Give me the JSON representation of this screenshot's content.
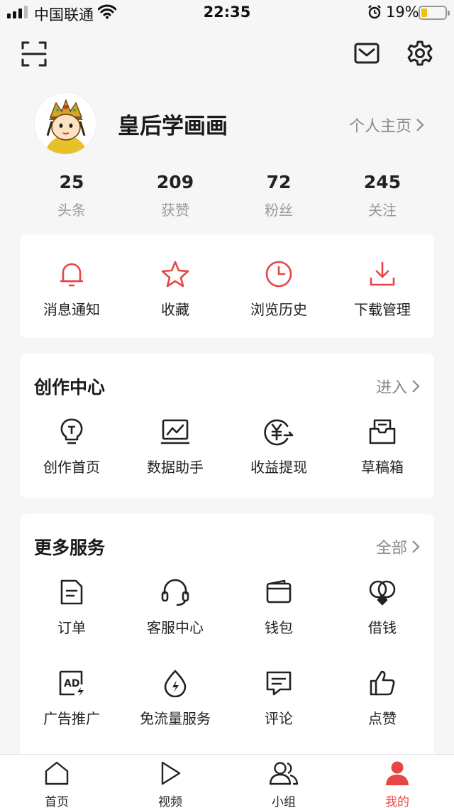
{
  "status_bar": {
    "carrier": "中国联通",
    "time": "22:35",
    "battery": "19%"
  },
  "profile": {
    "nickname": "皇后学画画",
    "homepage_label": "个人主页"
  },
  "stats": [
    {
      "value": "25",
      "label": "头条"
    },
    {
      "value": "209",
      "label": "获赞"
    },
    {
      "value": "72",
      "label": "粉丝"
    },
    {
      "value": "245",
      "label": "关注"
    }
  ],
  "quick_actions": [
    {
      "label": "消息通知",
      "icon": "bell-icon"
    },
    {
      "label": "收藏",
      "icon": "star-icon"
    },
    {
      "label": "浏览历史",
      "icon": "clock-icon"
    },
    {
      "label": "下载管理",
      "icon": "download-icon"
    }
  ],
  "creator_center": {
    "title": "创作中心",
    "more": "进入",
    "items": [
      {
        "label": "创作首页",
        "icon": "lightbulb-icon"
      },
      {
        "label": "数据助手",
        "icon": "chart-monitor-icon"
      },
      {
        "label": "收益提现",
        "icon": "yen-exchange-icon"
      },
      {
        "label": "草稿箱",
        "icon": "draft-box-icon"
      }
    ]
  },
  "more_services": {
    "title": "更多服务",
    "more": "全部",
    "items": [
      {
        "label": "订单",
        "icon": "document-icon"
      },
      {
        "label": "客服中心",
        "icon": "headset-icon"
      },
      {
        "label": "钱包",
        "icon": "wallet-icon"
      },
      {
        "label": "借钱",
        "icon": "loan-icon"
      },
      {
        "label": "广告推广",
        "icon": "ad-icon"
      },
      {
        "label": "免流量服务",
        "icon": "data-drop-icon"
      },
      {
        "label": "评论",
        "icon": "comment-icon"
      },
      {
        "label": "点赞",
        "icon": "thumbs-up-icon"
      }
    ]
  },
  "tabbar": [
    {
      "label": "首页",
      "icon": "home-icon"
    },
    {
      "label": "视频",
      "icon": "play-icon"
    },
    {
      "label": "小组",
      "icon": "group-icon"
    },
    {
      "label": "我的",
      "icon": "user-icon",
      "active": true
    }
  ],
  "colors": {
    "accent": "#e84545",
    "background": "#f6f6f6",
    "card": "#ffffff",
    "battery": "#f2c200"
  }
}
